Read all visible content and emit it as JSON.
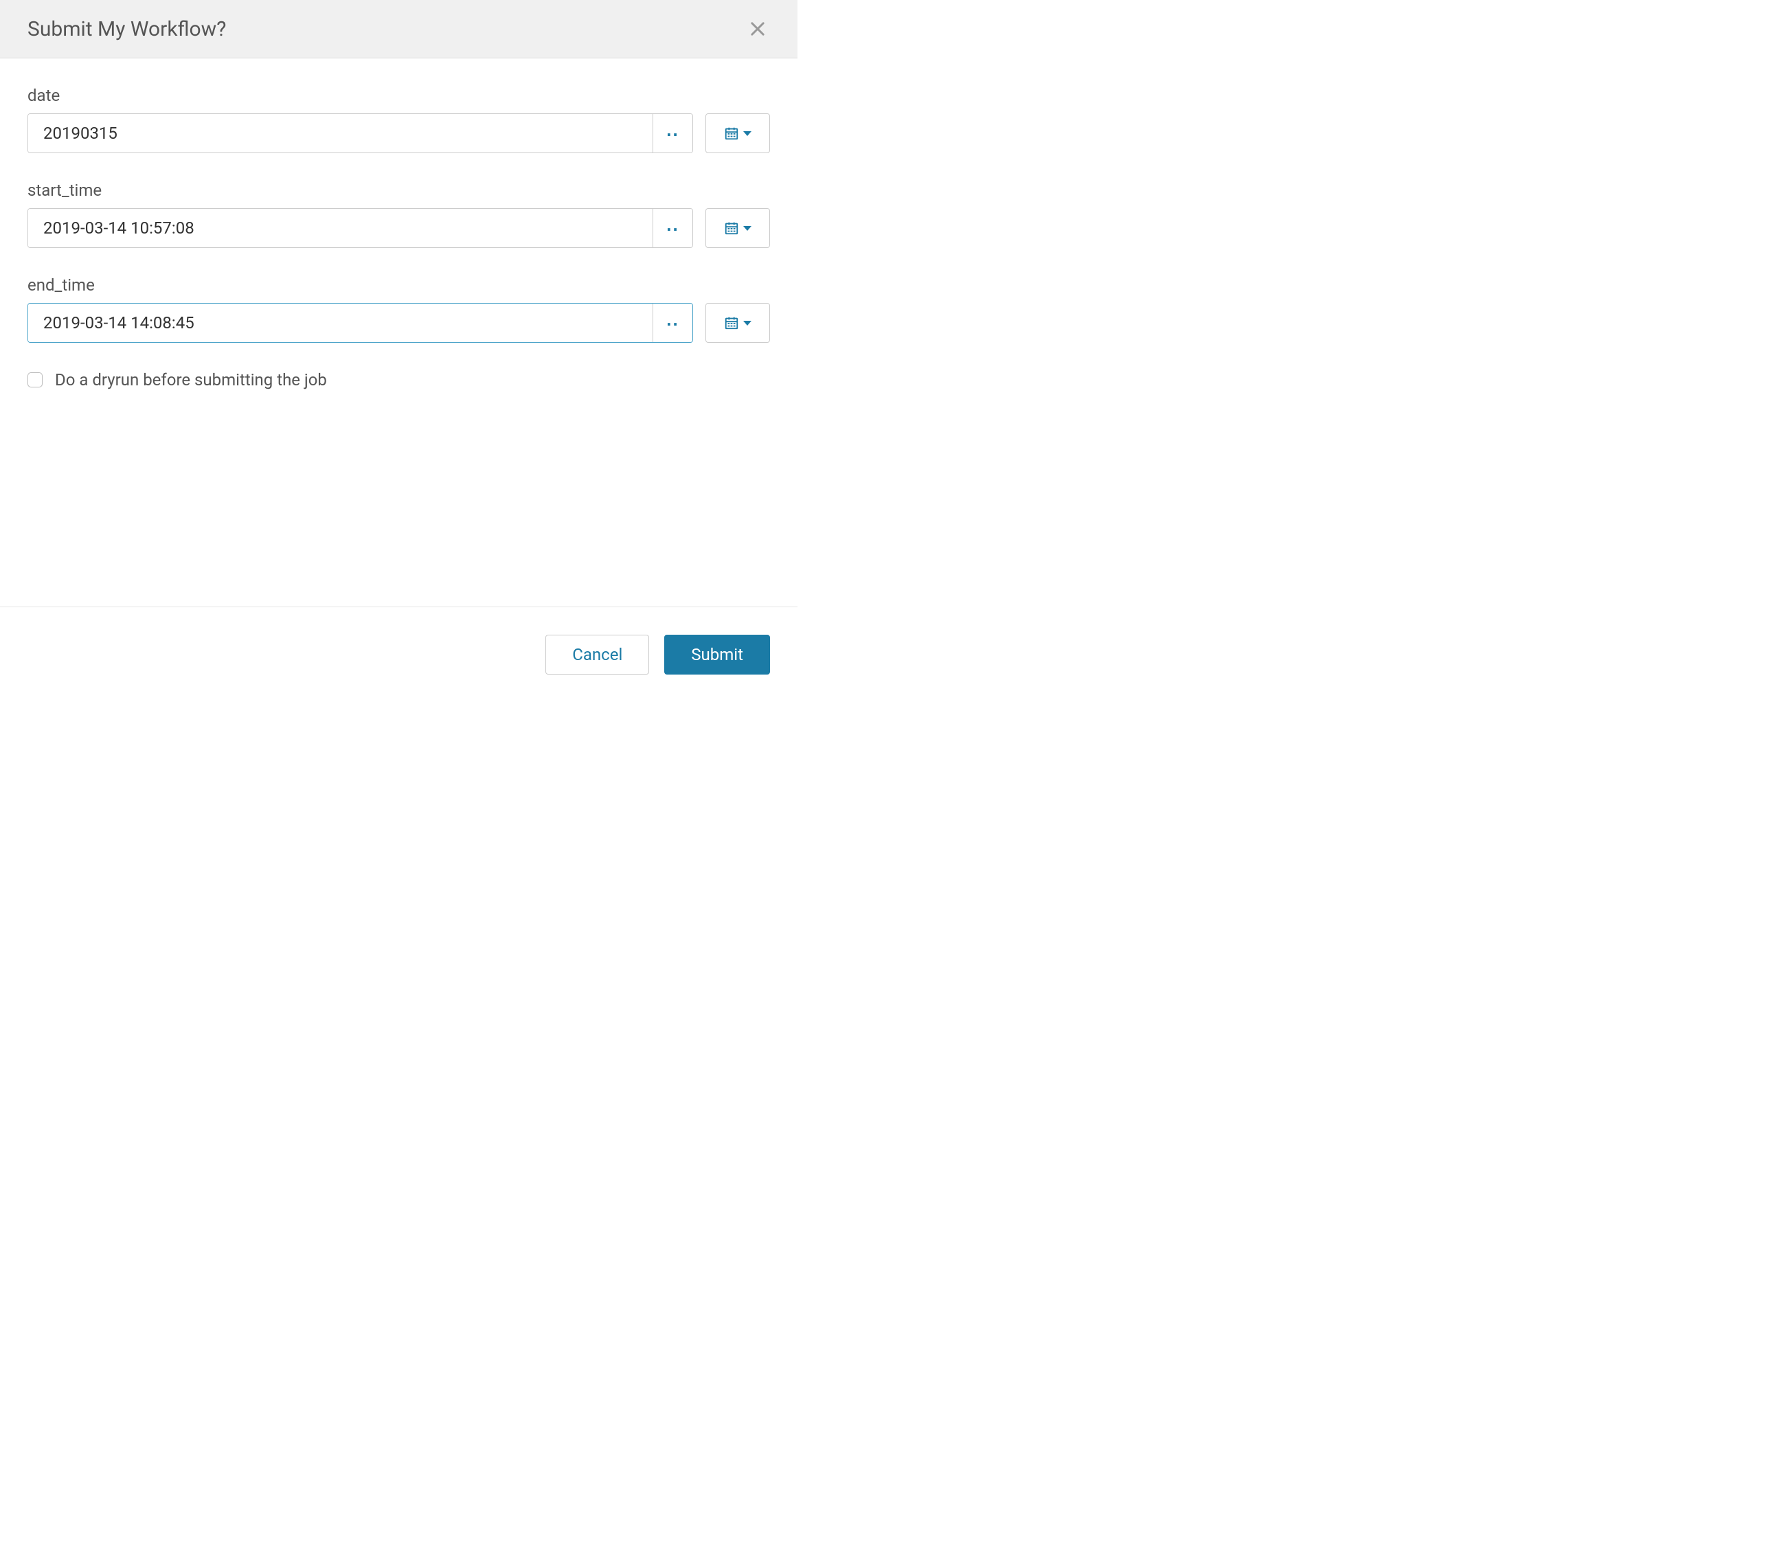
{
  "modal": {
    "title": "Submit My Workflow?"
  },
  "fields": {
    "date": {
      "label": "date",
      "value": "20190315"
    },
    "start_time": {
      "label": "start_time",
      "value": "2019-03-14 10:57:08"
    },
    "end_time": {
      "label": "end_time",
      "value": "2019-03-14 14:08:45"
    }
  },
  "dryrun": {
    "label": "Do a dryrun before submitting the job",
    "checked": false
  },
  "footer": {
    "cancel_label": "Cancel",
    "submit_label": "Submit"
  },
  "dots": ".."
}
